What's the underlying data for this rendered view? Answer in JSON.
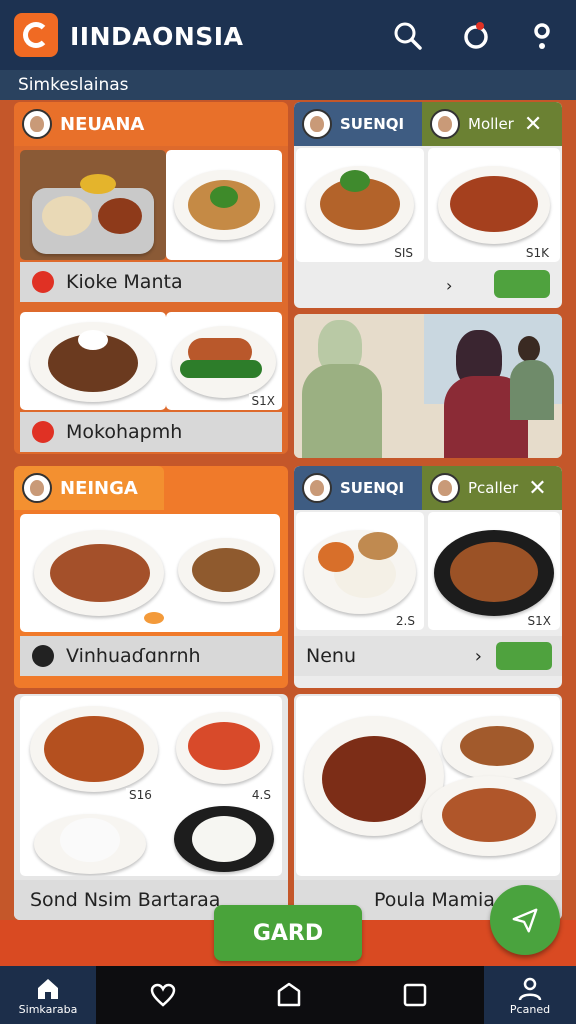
{
  "app": {
    "title": "IINDAONSIA",
    "subtitle": "Simkeslainas"
  },
  "panels": {
    "p1": {
      "header": "NEUANA",
      "item1": "Kioke Manta",
      "item2": "Mokohapmh",
      "price": "S1X"
    },
    "p2": {
      "header_left": "SUENQI",
      "header_right": "Moller",
      "price_a": "SIS",
      "price_b": "S1K"
    },
    "p4": {
      "header": "NEINGA",
      "item": "Vinhuaɗɑnrnh"
    },
    "p5": {
      "header_left": "SUENQI",
      "header_right": "Pcaller",
      "price_a": "2.S",
      "price_b": "S1X",
      "item": "Nenu"
    },
    "p6": {
      "price_a": "S16",
      "price_b": "4.S",
      "item": "Sond Nsim Bartaraa"
    },
    "p7": {
      "item": "Poula Mamia"
    }
  },
  "buttons": {
    "gard": "GARD"
  },
  "nav": {
    "left": "Simkaraba",
    "right": "Pcaned"
  },
  "colors": {
    "brand_orange": "#f06a23",
    "appbar": "#1d3251",
    "green": "#4fa23e",
    "panel_orange": "#e8702a"
  },
  "icons": [
    "search-icon",
    "record-icon",
    "profile-icon",
    "home-icon",
    "heart-icon",
    "circle-icon",
    "square-icon",
    "send-icon",
    "close-icon",
    "chevron-right-icon"
  ]
}
